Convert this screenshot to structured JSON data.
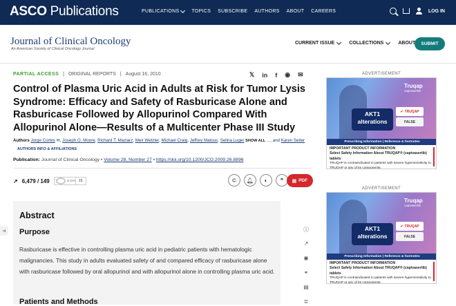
{
  "topbar": {
    "logo_bold": "ASCO",
    "logo_rest": " Publications",
    "nav": [
      {
        "label": "PUBLICATIONS",
        "dropdown": true
      },
      {
        "label": "TOPICS"
      },
      {
        "label": "SUBSCRIBE"
      },
      {
        "label": "AUTHORS"
      },
      {
        "label": "ABOUT"
      },
      {
        "label": "CAREERS"
      }
    ],
    "login": "LOG IN"
  },
  "journal": {
    "name": "Journal of Clinical Oncology",
    "subtitle": "An American Society of Clinical Oncology Journal",
    "nav": [
      "CURRENT ISSUE",
      "COLLECTIONS",
      "ABOUT"
    ],
    "submit": "SUBMIT"
  },
  "article": {
    "access": "PARTIAL ACCESS",
    "type": "ORIGINAL REPORTS",
    "date": "August 16, 2010",
    "title": "Control of Plasma Uric Acid in Adults at Risk for Tumor Lysis Syndrome: Efficacy and Safety of Rasburicase Alone and Rasburicase Followed by Allopurinol Compared With Allopurinol Alone—Results of a Multicenter Phase III Study",
    "authors_label": "Authors",
    "authors": [
      "Jorge Cortes",
      "Joseph O. Moore",
      "Richard T. Maziarz",
      "Meir Wetzler",
      "Michael Craig",
      "Jeffrey Matous",
      "Selina Luger"
    ],
    "show_all": "SHOW ALL",
    "and_more": "..., and",
    "last_author": "Karen Seiter",
    "author_info": "AUTHORS INFO & AFFILIATIONS",
    "publication_label": "Publication:",
    "publication": "Journal of Clinical Oncology",
    "volume": "Volume 28, Number 27",
    "doi": "https://doi.org/10.1200/JCO.2009.26.8896",
    "metrics": "6,479 / 149",
    "altmetric_word": "score",
    "altmetric": "15",
    "pdf": "PDF"
  },
  "abstract": {
    "heading": "Abstract",
    "purpose_heading": "Purpose",
    "purpose_text": "Rasburicase is effective in controlling plasma uric acid in pediatric patients with hematologic malignancies. This study in adults evaluated safety of and compared efficacy of rasburicase alone with rasburicase followed by oral allopurinol and with allopurinol alone in controlling plasma uric acid.",
    "methods_heading": "Patients and Methods"
  },
  "ads": [
    {
      "label": "ADVERTISEMENT",
      "brand": "Truqap",
      "brand_sub": "capivasertib",
      "headline1": "AKT1",
      "headline2": "alterations",
      "true_label": "TRUQAP",
      "false_label": "FALSE",
      "bar": "Prescribing Information | Reference & footnotes",
      "info_title": "IMPORTANT PRODUCT INFORMATION",
      "info_line1": "Select Safety Information About TRUQAP® (capivasertib) tablets",
      "info_line2": "TRUQAP is contraindicated in patients with severe hypersensitivity to TRUQAP or any of its components."
    },
    {
      "label": "ADVERTISEMENT",
      "brand": "Truqap",
      "brand_sub": "capivasertib",
      "headline1": "AKT1",
      "headline2": "alterations",
      "true_label": "TRUQAP",
      "false_label": "FALSE",
      "bar": "Prescribing Information | Reference & footnotes",
      "info_title": "IMPORTANT PRODUCT INFORMATION",
      "info_line1": "Select Safety Information About TRUQAP® (capivasertib) tablets",
      "info_line2": "TRUQAP is contraindicated in patients with severe hypersensitivity to TRUQAP or any of its components."
    }
  ],
  "colors": {
    "topbar": "#0e2a55",
    "accent_green": "#3f9a2c",
    "submit_teal": "#137d7b",
    "pdf_red": "#d5272d"
  }
}
